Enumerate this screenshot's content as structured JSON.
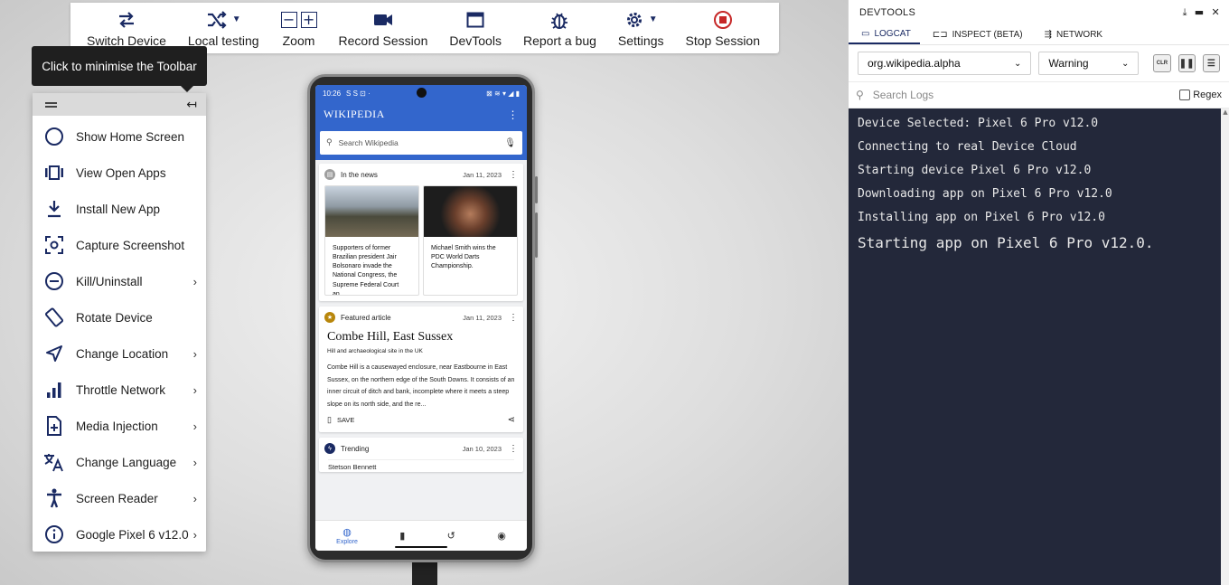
{
  "toolbar": {
    "items": [
      {
        "label": "Switch Device",
        "icon": "swap-arrows-icon"
      },
      {
        "label": "Local testing",
        "icon": "shuffle-icon",
        "has_dropdown": true
      },
      {
        "label": "Zoom",
        "icon": "zoom-icons",
        "minus": "−",
        "plus": "+"
      },
      {
        "label": "Record Session",
        "icon": "video-camera-icon"
      },
      {
        "label": "DevTools",
        "icon": "browser-window-icon"
      },
      {
        "label": "Report a bug",
        "icon": "bug-icon"
      },
      {
        "label": "Settings",
        "icon": "gear-icon",
        "has_dropdown": true
      },
      {
        "label": "Stop Session",
        "icon": "stop-icon"
      }
    ]
  },
  "tooltip": {
    "text": "Click to minimise the Toolbar"
  },
  "side_menu": {
    "items": [
      {
        "label": "Show Home Screen",
        "icon": "home-circle-icon",
        "submenu": false
      },
      {
        "label": "View Open Apps",
        "icon": "open-apps-icon",
        "submenu": false
      },
      {
        "label": "Install New App",
        "icon": "download-icon",
        "submenu": false
      },
      {
        "label": "Capture Screenshot",
        "icon": "screenshot-icon",
        "submenu": false
      },
      {
        "label": "Kill/Uninstall",
        "icon": "minus-circle-icon",
        "submenu": true
      },
      {
        "label": "Rotate Device",
        "icon": "rotate-device-icon",
        "submenu": false
      },
      {
        "label": "Change Location",
        "icon": "location-arrow-icon",
        "submenu": true
      },
      {
        "label": "Throttle Network",
        "icon": "signal-bars-icon",
        "submenu": true
      },
      {
        "label": "Media Injection",
        "icon": "media-file-icon",
        "submenu": true
      },
      {
        "label": "Change Language",
        "icon": "translate-icon",
        "submenu": true
      },
      {
        "label": "Screen Reader",
        "icon": "accessibility-icon",
        "submenu": true
      },
      {
        "label": "Google Pixel 6  v12.0",
        "icon": "info-icon",
        "submenu": true
      }
    ],
    "arrow": "›"
  },
  "phone": {
    "status_time": "10:26",
    "status_icons": "S S ⊡ ·",
    "status_right": "⊠ ≋ ▾ ◢ ▮",
    "app_title": "WIKIPEDIA",
    "search_placeholder": "Search Wikipedia",
    "news_card": {
      "title": "In the news",
      "date": "Jan 11, 2023",
      "items": [
        "Supporters of former Brazilian president Jair Bolsonaro invade the National Congress, the Supreme Federal Court an...",
        "Michael Smith wins the PDC World Darts Championship."
      ]
    },
    "featured_card": {
      "title": "Featured article",
      "date": "Jan 11, 2023",
      "article_title": "Combe Hill, East Sussex",
      "article_subtitle": "Hill and archaeological site in the UK",
      "article_body": "Combe Hill is a causewayed enclosure, near Eastbourne in East Sussex, on the northern edge of the South Downs. It consists of an inner circuit of ditch and bank, incomplete where it meets a steep slope on its north side, and the re...",
      "save_label": "SAVE"
    },
    "trending_card": {
      "title": "Trending",
      "date": "Jan 10, 2023",
      "first_item": "Stetson Bennett"
    },
    "bottom_nav": {
      "explore_label": "Explore"
    }
  },
  "devtools": {
    "title": "DEVTOOLS",
    "tabs": [
      {
        "label": "LOGCAT",
        "active": true,
        "icon": "logcat-icon"
      },
      {
        "label": "INSPECT (BETA)",
        "active": false,
        "icon": "inspect-icon"
      },
      {
        "label": "NETWORK",
        "active": false,
        "icon": "network-icon"
      }
    ],
    "package_select": "org.wikipedia.alpha",
    "level_select": "Warning",
    "clear_label": "CLR",
    "search_placeholder": "Search Logs",
    "regex_label": "Regex",
    "logs": [
      "Device Selected: Pixel 6 Pro v12.0",
      "Connecting to real Device Cloud",
      "Starting device Pixel 6 Pro v12.0",
      "Downloading app on Pixel 6 Pro v12.0",
      "Installing app on Pixel 6 Pro v12.0",
      "Starting app on Pixel 6 Pro v12.0."
    ]
  },
  "colors": {
    "icon_navy": "#1a2a63",
    "stop_red": "#c62828",
    "wiki_blue": "#3366cc",
    "console_bg": "#23283a"
  }
}
